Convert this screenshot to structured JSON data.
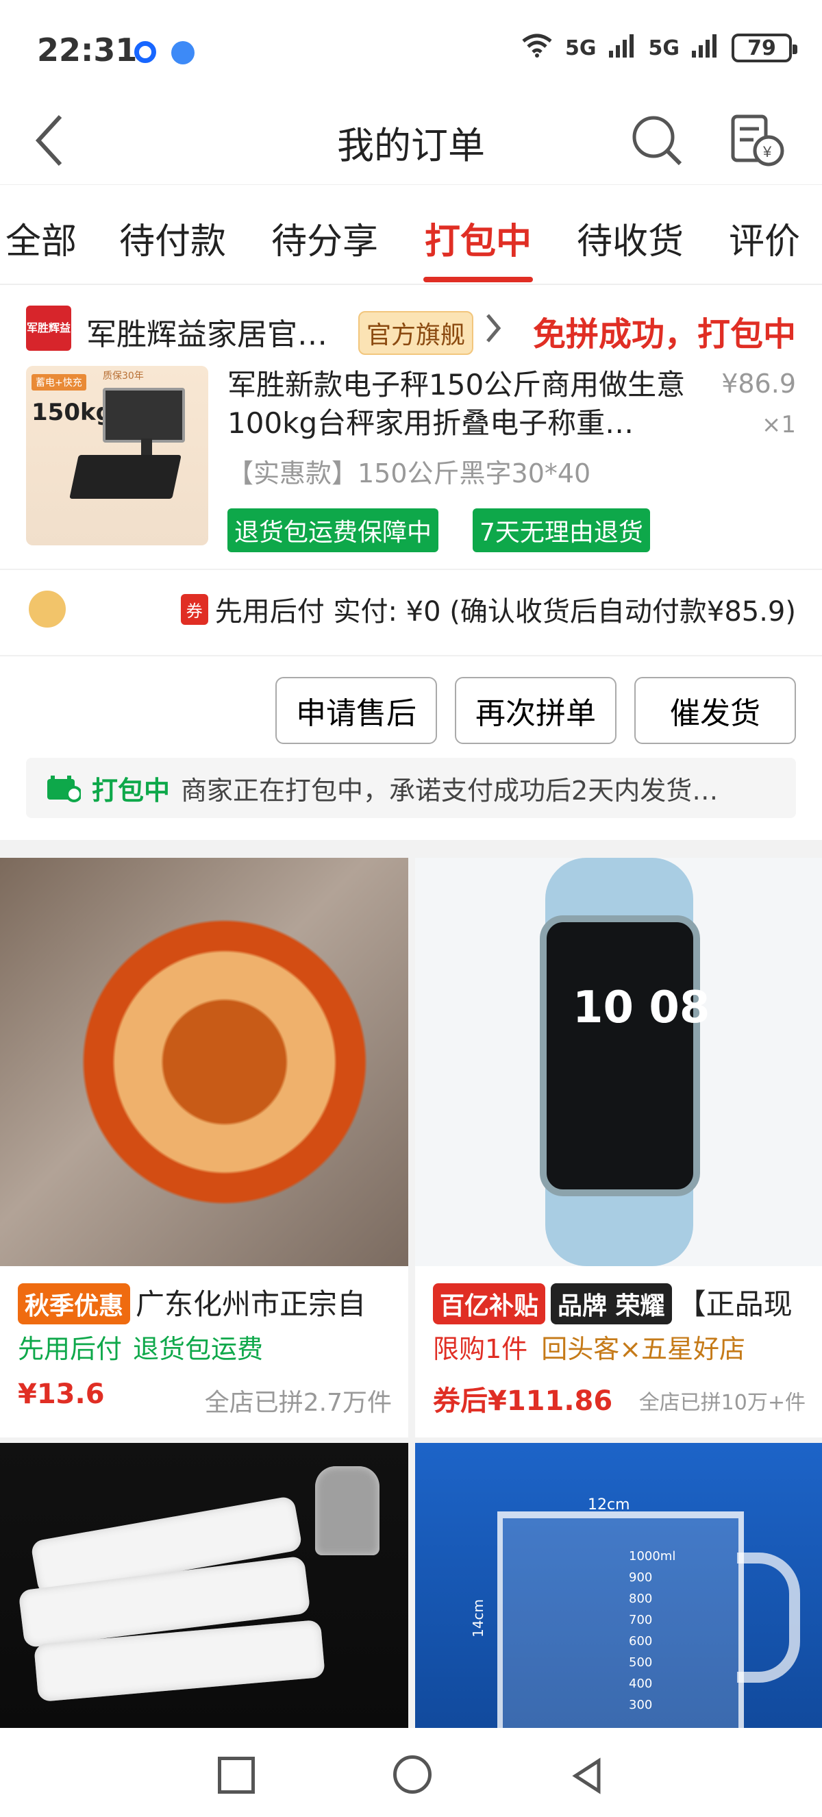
{
  "status_bar": {
    "time": "22:31",
    "network_left": "5G",
    "network_right": "5G",
    "battery": "79"
  },
  "header": {
    "title": "我的订单"
  },
  "tabs": [
    {
      "label": "全部"
    },
    {
      "label": "待付款"
    },
    {
      "label": "待分享"
    },
    {
      "label": "打包中"
    },
    {
      "label": "待收货"
    },
    {
      "label": "评价"
    }
  ],
  "order": {
    "shop_name": "军胜辉益家居官…",
    "shop_logo_text": "军胜辉益",
    "flagship": "官方旗舰",
    "status": "免拼成功，打包中",
    "product_title": "军胜新款电子秤150公斤商用做生意100kg台秤家用折叠电子称重…",
    "price": "¥86.9",
    "quantity": "×1",
    "spec": "【实惠款】150公斤黑字30*40",
    "tags": [
      "退货包运费保障中",
      "7天无理由退货"
    ],
    "pay_badge": "券",
    "pay_text": "先用后付 实付: ¥0 (确认收货后自动付款¥85.9)",
    "buttons": [
      "申请售后",
      "再次拼单",
      "催发货"
    ],
    "notice_status": "打包中",
    "notice_text": "商家正在打包中，承诺支付成功后2天内发货…",
    "image_text": {
      "weight": "150kg",
      "tag": "质保30年",
      "top": "蓄电+快充"
    }
  },
  "feed": [
    {
      "badge": "秋季优惠",
      "title": "广东化州市正宗自",
      "features": [
        "先用后付",
        "退货包运费"
      ],
      "price": "¥13.6",
      "sales": "全店已拼2.7万件"
    },
    {
      "badge": "百亿补贴",
      "brand": "品牌 荣耀",
      "title": "【正品现",
      "features": [
        "限购1件",
        "回头客×五星好店"
      ],
      "price": "券后¥111.86",
      "sales": "全店已拼10万+件",
      "watch_text": "10\n08"
    },
    {
      "title": "",
      "features": [],
      "price": "",
      "sales": ""
    },
    {
      "title": "",
      "features": [],
      "price": "",
      "sales": "",
      "measurements": [
        "12cm",
        "1000ml",
        "900",
        "800",
        "700",
        "600",
        "500",
        "400",
        "300",
        "14cm"
      ]
    }
  ],
  "colors": {
    "accent": "#e02e24",
    "green": "#0ea84a",
    "gray": "#999999"
  }
}
